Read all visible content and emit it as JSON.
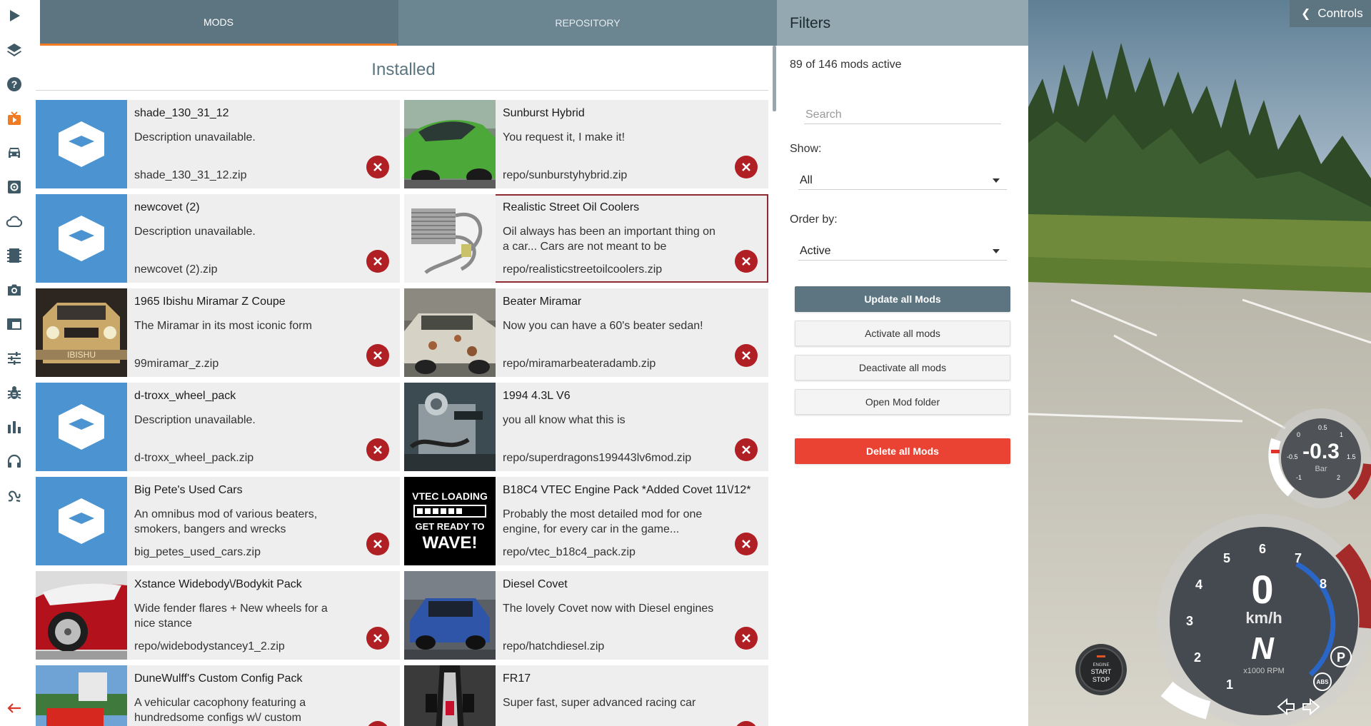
{
  "tabs": {
    "mods": "MODS",
    "repository": "REPOSITORY"
  },
  "installed_title": "Installed",
  "mods": [
    {
      "name": "shade_130_31_12",
      "desc": "Description unavailable.",
      "file": "shade_130_31_12.zip",
      "thumb": "default"
    },
    {
      "name": "Sunburst Hybrid",
      "desc": "You request it, I make it!",
      "file": "repo/sunburstyhybrid.zip",
      "thumb": "green-car"
    },
    {
      "name": "newcovet (2)",
      "desc": "Description unavailable.",
      "file": "newcovet (2).zip",
      "thumb": "default"
    },
    {
      "name": "Realistic Street Oil Coolers",
      "desc": "Oil always has been an important thing on a car... Cars are not meant to be",
      "file": "repo/realisticstreetoilcoolers.zip",
      "thumb": "oil-cooler",
      "selected": true
    },
    {
      "name": "1965 Ibishu Miramar Z Coupe",
      "desc": "The Miramar in its most iconic form",
      "file": "99miramar_z.zip",
      "thumb": "miramar"
    },
    {
      "name": "Beater Miramar",
      "desc": "Now you can have a 60's beater sedan!",
      "file": "repo/miramarbeateradamb.zip",
      "thumb": "rusty-car"
    },
    {
      "name": "d-troxx_wheel_pack",
      "desc": "Description unavailable.",
      "file": "d-troxx_wheel_pack.zip",
      "thumb": "default"
    },
    {
      "name": "1994 4.3L V6",
      "desc": "you all know what this is",
      "file": "repo/superdragons199443lv6mod.zip",
      "thumb": "engine"
    },
    {
      "name": "Big Pete's Used Cars",
      "desc": "An omnibus mod of various beaters, smokers, bangers and wrecks",
      "file": "big_petes_used_cars.zip",
      "thumb": "default"
    },
    {
      "name": "B18C4 VTEC Engine Pack *Added Covet 11\\/12*",
      "desc": "Probably the most detailed mod for one engine, for every car in the game...",
      "file": "repo/vtec_b18c4_pack.zip",
      "thumb": "vtec"
    },
    {
      "name": "Xstance Widebody\\/Bodykit Pack",
      "desc": "Wide fender flares + New wheels for a nice stance",
      "file": "repo/widebodystancey1_2.zip",
      "thumb": "red-car"
    },
    {
      "name": "Diesel Covet",
      "desc": "The lovely Covet now with Diesel engines",
      "file": "repo/hatchdiesel.zip",
      "thumb": "blue-car"
    },
    {
      "name": "DuneWulff's Custom Config Pack",
      "desc": "A vehicular cacophony featuring a hundredsome configs w\\/ custom",
      "file": "",
      "thumb": "dune"
    },
    {
      "name": "FR17",
      "desc": "Super fast, super advanced racing car",
      "file": "",
      "thumb": "fr17"
    }
  ],
  "vtec_text": {
    "line1": "VTEC LOADING",
    "line2": "GET READY TO",
    "line3": "WAVE!"
  },
  "miramar_text": "IBISHU",
  "filters": {
    "title": "Filters",
    "count": "89 of 146 mods active",
    "search_placeholder": "Search",
    "show_label": "Show:",
    "show_value": "All",
    "order_label": "Order by:",
    "order_value": "Active",
    "update_all": "Update all Mods",
    "activate_all": "Activate all mods",
    "deactivate_all": "Deactivate all mods",
    "open_folder": "Open Mod folder",
    "delete_all": "Delete all Mods"
  },
  "controls_label": "Controls",
  "hud": {
    "boost_value": "-0.3",
    "boost_unit": "Bar",
    "boost_ticks": [
      "0",
      "0.5",
      "1",
      "1.5",
      "2",
      "-1",
      "-0.5"
    ],
    "speed": "0",
    "speed_unit": "km/h",
    "gear": "N",
    "rpm_unit": "x1000 RPM",
    "rpm_ticks": [
      "1",
      "2",
      "3",
      "4",
      "5",
      "6",
      "7",
      "8"
    ],
    "engine_btn": [
      "ENGINE",
      "START",
      "STOP"
    ],
    "park": "P",
    "abs": "ABS"
  },
  "colors": {
    "accent": "#f07b23",
    "header": "#5c7581",
    "delete": "#b01f24",
    "danger_button": "#ea4334",
    "mod_default": "#4c93d1"
  }
}
